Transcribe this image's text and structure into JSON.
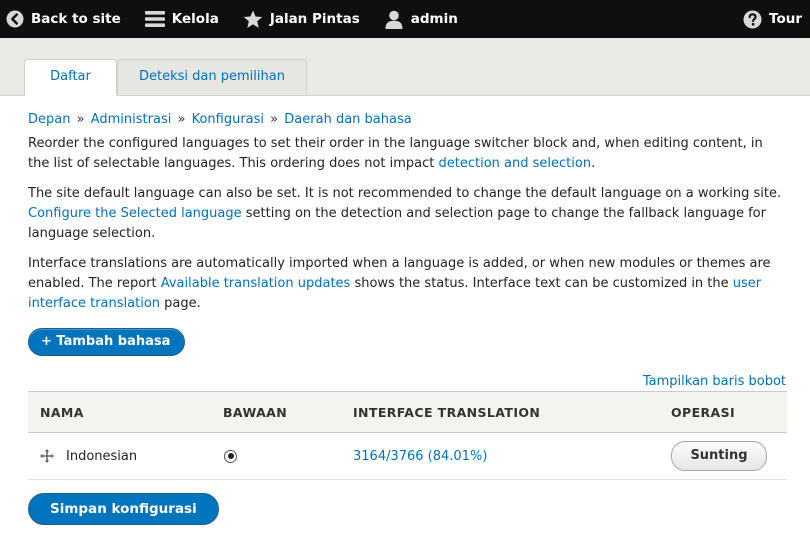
{
  "toolbar": {
    "back_label": "Back to site",
    "manage_label": "Kelola",
    "shortcuts_label": "Jalan Pintas",
    "user_label": "admin",
    "tour_label": "Tour"
  },
  "tabs": {
    "list_label": "Daftar",
    "detection_label": "Deteksi dan pemilihan"
  },
  "breadcrumb": {
    "items": [
      "Depan",
      "Administrasi",
      "Konfigurasi",
      "Daerah dan bahasa"
    ],
    "separator": "»"
  },
  "intro": {
    "p1_text": "Reorder the configured languages to set their order in the language switcher block and, when editing content, in the list of selectable languages. This ordering does not impact ",
    "p1_link": "detection and selection",
    "p1_end": ".",
    "p2_text": "The site default language can also be set. It is not recommended to change the default language on a working site. ",
    "p2_link": "Configure the Selected language",
    "p2_end": " setting on the detection and selection page to change the fallback language for language selection.",
    "p3_text": "Interface translations are automatically imported when a language is added, or when new modules or themes are enabled. The report ",
    "p3_link1": "Available translation updates",
    "p3_mid": " shows the status. Interface text can be customized in the ",
    "p3_link2": "user interface translation",
    "p3_end": " page."
  },
  "add_language_button": "+ Tambah bahasa",
  "show_weights_link": "Tampilkan baris bobot",
  "table": {
    "headers": [
      "NAMA",
      "BAWAAN",
      "INTERFACE TRANSLATION",
      "OPERASI"
    ],
    "rows": [
      {
        "name": "Indonesian",
        "is_default": true,
        "translation": "3164/3766 (84.01%)",
        "operation": "Sunting"
      }
    ]
  },
  "save_button": "Simpan konfigurasi",
  "colors": {
    "link": "#0071b8",
    "primary_button": "#0074bd",
    "toolbar_bg": "#0f0f0f",
    "tabs_bg": "#e9e9e6"
  }
}
